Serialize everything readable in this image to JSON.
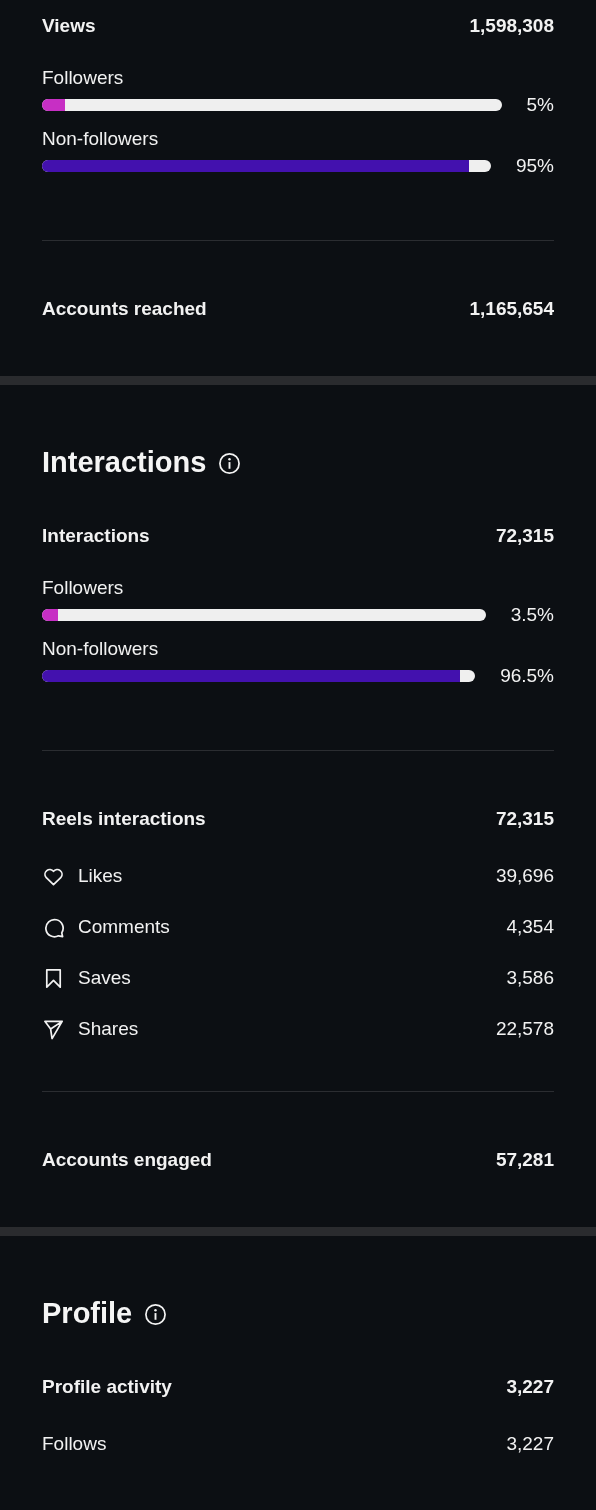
{
  "sections": [
    {
      "groups": [
        [
          {
            "kind": "total",
            "label": "Views",
            "value": "1,598,308"
          },
          {
            "kind": "bar",
            "label": "Followers",
            "value": "5%",
            "level": 0.05,
            "color": "#c72fc4"
          },
          {
            "kind": "bar",
            "label": "Non-followers",
            "value": "95%",
            "level": 0.95,
            "color": "#4311ae"
          }
        ],
        [
          {
            "kind": "total",
            "label": "Accounts reached",
            "value": "1,165,654"
          }
        ]
      ]
    },
    {
      "heading": "Interactions",
      "groups": [
        [
          {
            "kind": "total",
            "label": "Interactions",
            "value": "72,315"
          },
          {
            "kind": "bar",
            "label": "Followers",
            "value": "3.5%",
            "level": 0.035,
            "color": "#c72fc4"
          },
          {
            "kind": "bar",
            "label": "Non-followers",
            "value": "96.5%",
            "level": 0.965,
            "color": "#4311ae"
          }
        ],
        [
          {
            "kind": "total",
            "label": "Reels interactions",
            "value": "72,315"
          },
          {
            "kind": "like",
            "label": "Likes",
            "value": "39,696"
          },
          {
            "kind": "comment",
            "label": "Comments",
            "value": "4,354"
          },
          {
            "kind": "save",
            "label": "Saves",
            "value": "3,586"
          },
          {
            "kind": "share",
            "label": "Shares",
            "value": "22,578"
          }
        ],
        [
          {
            "kind": "total",
            "label": "Accounts engaged",
            "value": "57,281"
          }
        ]
      ]
    },
    {
      "heading": "Profile",
      "groups": [
        [
          {
            "kind": "total",
            "label": "Profile activity",
            "value": "3,227"
          },
          {
            "kind": "plain",
            "label": "Follows",
            "value": "3,227"
          }
        ]
      ]
    }
  ]
}
